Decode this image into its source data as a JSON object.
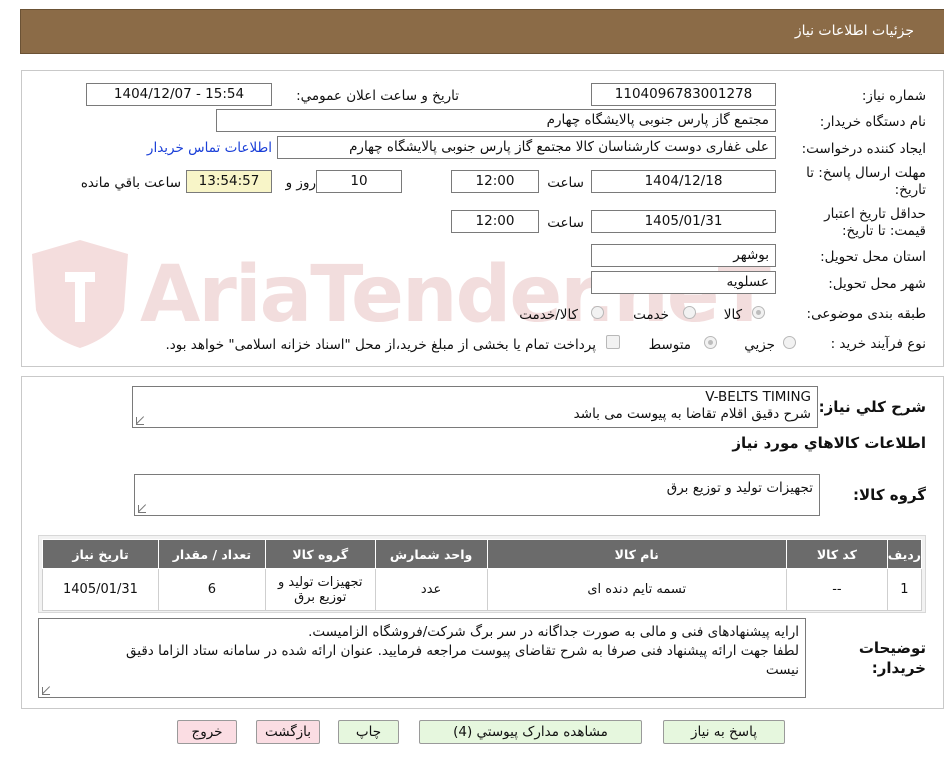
{
  "header": {
    "title": "جزئیات اطلاعات نیاز"
  },
  "form": {
    "need_number": {
      "label": "شماره نیاز:",
      "value": "1104096783001278"
    },
    "announce_datetime": {
      "label": "تاریخ و ساعت اعلان عمومي:",
      "value": "1404/12/07 - 15:54"
    },
    "buyer_org": {
      "label": "نام دستگاه خریدار:",
      "value": "مجتمع گاز پارس جنوبی  پالایشگاه چهارم"
    },
    "requester": {
      "label": "ایجاد کننده درخواست:",
      "value": "علی غفاری دوست کارشناسان کالا مجتمع گاز پارس جنوبی  پالایشگاه چهارم"
    },
    "buyer_contact_link": "اطلاعات تماس خریدار",
    "reply_deadline": {
      "label": "مهلت ارسال پاسخ: تا تاریخ:",
      "date": "1404/12/18",
      "time_label": "ساعت",
      "time": "12:00",
      "days": "10",
      "days_label": "روز و",
      "remaining": "13:54:57",
      "remaining_label": "ساعت باقي مانده"
    },
    "price_validity": {
      "label": "حداقل تاریخ اعتبار قیمت: تا تاریخ:",
      "date": "1405/01/31",
      "time_label": "ساعت",
      "time": "12:00"
    },
    "province": {
      "label": "استان محل تحویل:",
      "value": "بوشهر"
    },
    "city": {
      "label": "شهر محل تحویل:",
      "value": "عسلویه"
    },
    "category": {
      "label": "طبقه بندی موضوعی:",
      "options": [
        "کالا",
        "خدمت",
        "کالا/خدمت"
      ],
      "selected": "کالا"
    },
    "purchase_type": {
      "label": "نوع فرآیند خرید :",
      "options": [
        "جزیي",
        "متوسط"
      ],
      "selected": "متوسط",
      "payment_note": "پرداخت تمام یا بخشی از مبلغ خرید،از محل \"اسناد خزانه اسلامی\" خواهد بود."
    }
  },
  "summary": {
    "label": "شرح کلي نیاز:",
    "line1": "V-BELTS TIMING",
    "line2": "شرح دقیق اقلام تقاضا به پیوست می باشد"
  },
  "goods_info": {
    "title": "اطلاعات کالاهاي مورد نیاز",
    "group_label": "گروه کالا:",
    "group_value": "تجهیزات تولید و توزیع برق"
  },
  "table": {
    "headers": [
      "ردیف",
      "کد کالا",
      "نام کالا",
      "واحد شمارش",
      "گروه کالا",
      "تعداد / مقدار",
      "تاریخ نیاز"
    ],
    "rows": [
      [
        "1",
        "--",
        "تسمه تایم دنده ای",
        "عدد",
        "تجهیزات تولید و توزیع برق",
        "6",
        "1405/01/31"
      ]
    ]
  },
  "buyer_notes": {
    "label": "توضیحات خریدار:",
    "line1": "ارایه پیشنهادهای فنی و مالی به صورت جداگانه در سر برگ شرکت/فروشگاه الزامیست.",
    "line2": "لطفا جهت ارائه پیشنهاد فنی صرفا به شرح تقاضای پیوست مراجعه فرمایید. عنوان ارائه شده در سامانه ستاد الزاما دقیق",
    "line3": "نیست"
  },
  "buttons": {
    "reply": "پاسخ به نیاز",
    "attachments": "مشاهده مدارک پیوستي (4)",
    "print": "چاپ",
    "back": "بازگشت",
    "exit": "خروج"
  },
  "watermark": {
    "text": "AriaTender.neT"
  },
  "colors": {
    "header_bg": "#8b6b47",
    "link": "#1a3fd8",
    "table_header_bg": "#6b6b6b",
    "button_green": "#e6f7de",
    "button_pink": "#fbdde3",
    "remaining_bg": "#f8f5c8"
  }
}
